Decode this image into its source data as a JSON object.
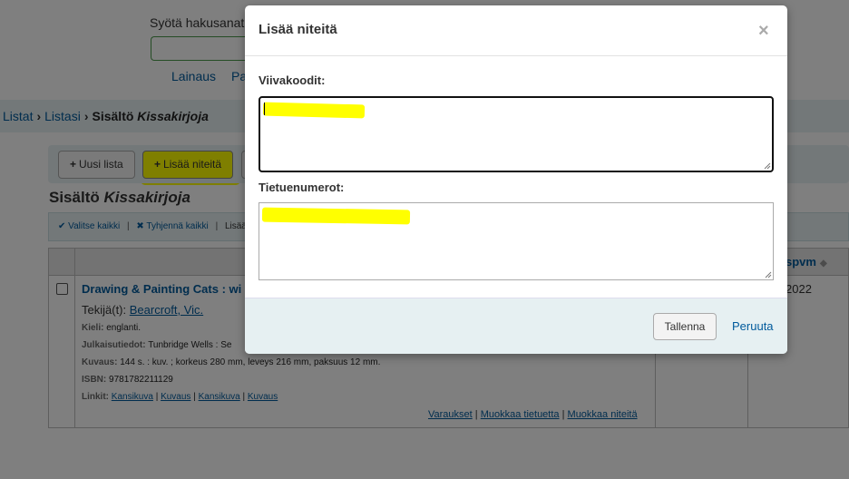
{
  "search": {
    "label": "Syötä hakusanat:",
    "tabs": [
      "Lainaus",
      "Pa"
    ]
  },
  "breadcrumb": {
    "items": [
      "Listat",
      "Listasi"
    ],
    "current_prefix": "Sisältö",
    "current_name": "Kissakirjoja"
  },
  "toolbar": {
    "new_list": "Uusi lista",
    "add_items": "Lisää niteitä"
  },
  "page_title": {
    "prefix": "Sisältö",
    "name": "Kissakirjoja"
  },
  "selection_bar": {
    "select_all": "Valitse kaikki",
    "clear_all": "Tyhjennä kaikki",
    "more": "Lisää"
  },
  "table": {
    "date_header": "spvm",
    "row": {
      "title": "Drawing & Painting Cats : wi",
      "author_label": "Tekijä(t):",
      "author": "Bearcroft, Vic.",
      "language_label": "Kieli:",
      "language": "englanti.",
      "publication_label": "Julkaisutiedot:",
      "publication": "Tunbridge Wells : Se",
      "description_label": "Kuvaus:",
      "description": "144 s. : kuv. ; korkeus 280 mm, leveys 216 mm, paksuus 12 mm.",
      "isbn_label": "ISBN:",
      "isbn": "9781782211129",
      "links_label": "Linkit:",
      "links": [
        "Kansikuva",
        "Kuvaus",
        "Kansikuva",
        "Kuvaus"
      ],
      "actions": [
        "Varaukset",
        "Muokkaa tietuetta",
        "Muokkaa niteitä"
      ],
      "date": "2022"
    }
  },
  "modal": {
    "title": "Lisää niteitä",
    "close": "×",
    "barcodes_label": "Viivakoodit:",
    "records_label": "Tietuenumerot:",
    "save": "Tallenna",
    "cancel": "Peruuta"
  },
  "highlight_color": "#ffff00",
  "link_color": "#005a9c"
}
